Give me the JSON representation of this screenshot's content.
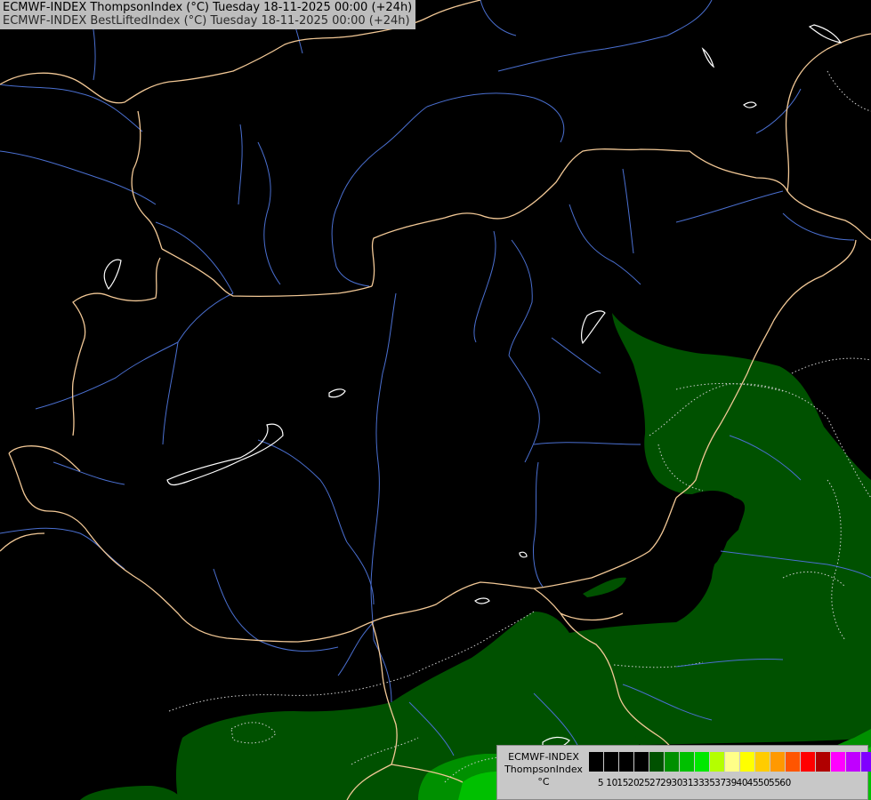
{
  "title": {
    "line1": "ECMWF-INDEX ThompsonIndex (°C) Tuesday 18-11-2025 00:00 (+24h)",
    "line2": "ECMWF-INDEX BestLiftedIndex (°C) Tuesday 18-11-2025 00:00 (+24h)"
  },
  "legend": {
    "name_lines": [
      "ECMWF-INDEX",
      "ThompsonIndex",
      "°C"
    ],
    "swatches": [
      "#000000",
      "#000000",
      "#000000",
      "#000000",
      "#005100",
      "#009000",
      "#00c000",
      "#00e800",
      "#b4ff00",
      "#ffff88",
      "#ffff00",
      "#ffcc00",
      "#ff9900",
      "#ff5500",
      "#ff0000",
      "#b00000",
      "#ff00ff",
      "#c000ff",
      "#8000ff",
      "#4000ff",
      "#0000ff"
    ],
    "ticks": [
      "5",
      "10",
      "15",
      "20",
      "25",
      "27",
      "29",
      "30",
      "31",
      "33",
      "35",
      "37",
      "39",
      "40",
      "45",
      "50",
      "55",
      "60"
    ]
  },
  "map_colors": {
    "background": "#000000",
    "field_low": "#005100",
    "field_mid": "#009000",
    "field_high": "#00c000",
    "border": "#f2c896",
    "rivers": "#4a6fd0",
    "lakes": "#ffffff",
    "contours": "#d0d0d0"
  }
}
